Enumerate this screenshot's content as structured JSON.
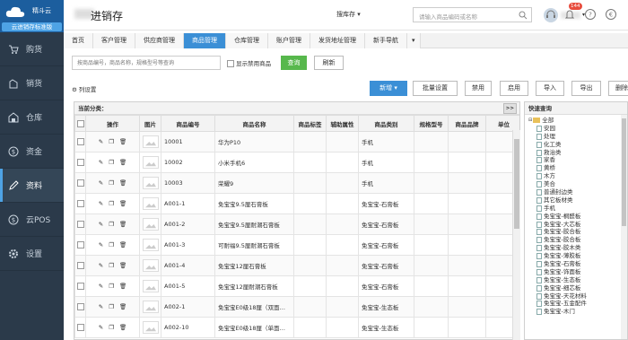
{
  "logo": {
    "brand": "精斗云",
    "edition": "云进销存标准版"
  },
  "sidebar": [
    {
      "label": "购货",
      "icon": "cart-icon"
    },
    {
      "label": "销货",
      "icon": "sales-icon"
    },
    {
      "label": "仓库",
      "icon": "warehouse-icon"
    },
    {
      "label": "资金",
      "icon": "money-icon"
    },
    {
      "label": "资料",
      "icon": "pencil-icon",
      "active": true
    },
    {
      "label": "云POS",
      "icon": "pos-icon"
    },
    {
      "label": "设置",
      "icon": "gear-icon"
    }
  ],
  "topbar": {
    "title": "进销存",
    "scope": "搜库存",
    "search_placeholder": "请输入商品编码或名称",
    "notif_count": "144"
  },
  "tabs": [
    "首页",
    "客户管理",
    "供应商管理",
    "商品管理",
    "仓库管理",
    "账户管理",
    "发货地址管理",
    "新手导航",
    "▾"
  ],
  "active_tab": 3,
  "filter": {
    "placeholder": "按商品编号，商品名称，规格型号等查询",
    "disabled_label": "显示禁用商品",
    "query": "查询",
    "refresh": "刷新"
  },
  "toolbar": {
    "column_settings": "列设置",
    "new": "新增",
    "batch": "批量设置",
    "disable": "禁用",
    "enable": "启用",
    "import": "导入",
    "export": "导出",
    "delete": "删除"
  },
  "grid": {
    "category_label": "当前分类：",
    "collapse": ">>",
    "columns": [
      "",
      "操作",
      "图片",
      "商品编号",
      "商品名称",
      "商品标签",
      "辅助属性",
      "商品类别",
      "规格型号",
      "商品品牌",
      "单位"
    ],
    "rows": [
      {
        "code": "10001",
        "name": "华为P10",
        "category": "手机"
      },
      {
        "code": "10002",
        "name": "小米手机6",
        "category": "手机"
      },
      {
        "code": "10003",
        "name": "荣耀9",
        "category": "手机"
      },
      {
        "code": "A001-1",
        "name": "免宝宝9.5厘石膏板",
        "category": "免宝宝-石膏板"
      },
      {
        "code": "A001-2",
        "name": "免宝宝9.5厘耐潮石膏板",
        "category": "免宝宝-石膏板"
      },
      {
        "code": "A001-3",
        "name": "可耐福9.5厘耐潮石膏板",
        "category": "免宝宝-石膏板"
      },
      {
        "code": "A001-4",
        "name": "免宝宝12厘石膏板",
        "category": "免宝宝-石膏板"
      },
      {
        "code": "A001-5",
        "name": "免宝宝12厘耐潮石膏板",
        "category": "免宝宝-石膏板"
      },
      {
        "code": "A002-1",
        "name": "免宝宝E0级18厘（双面…",
        "category": "免宝宝-生态板"
      },
      {
        "code": "A002-10",
        "name": "免宝宝E0级18厘（单面…",
        "category": "免宝宝-生态板"
      }
    ]
  },
  "tree": {
    "title": "快速查询",
    "collapse": "<<",
    "root": "全部",
    "nodes": [
      "安园",
      "处理",
      "化工类",
      "救治类",
      "家香",
      "黄桥",
      "木方",
      "美合",
      "普通封边类",
      "其它板材类",
      "手机",
      "免宝宝-桐醛板",
      "免宝宝-大芯板",
      "免宝宝-胶合板",
      "免宝宝-胶合板",
      "免宝宝-胶木类",
      "免宝宝-薄胶板",
      "免宝宝-石膏板",
      "免宝宝-饰面板",
      "免宝宝-生态板",
      "免宝宝-细芯板",
      "免宝宝-天花材料",
      "免宝宝-五金配件",
      "免宝宝-木门"
    ]
  }
}
